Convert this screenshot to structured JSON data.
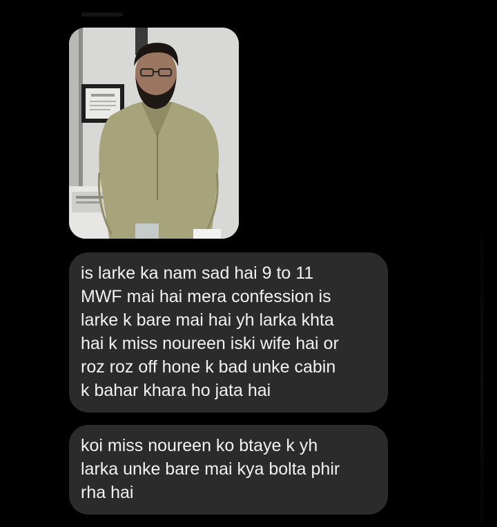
{
  "messages": [
    {
      "type": "image",
      "icon": "photo-man-in-kurta"
    },
    {
      "type": "text",
      "text": "is larke ka nam sad hai 9 to 11\nMWF mai hai mera confession is\nlarke k bare  mai hai yh larka khta\nhai k miss noureen iski wife hai or\nroz roz off hone k bad unke cabin\nk bahar khara ho jata hai"
    },
    {
      "type": "text",
      "text": "koi miss noureen ko btaye k yh\nlarka unke bare mai kya bolta phir\nrha hai"
    }
  ],
  "colors": {
    "background": "#000000",
    "bubble": "#2b2b2b",
    "text": "#f2f2f2"
  }
}
